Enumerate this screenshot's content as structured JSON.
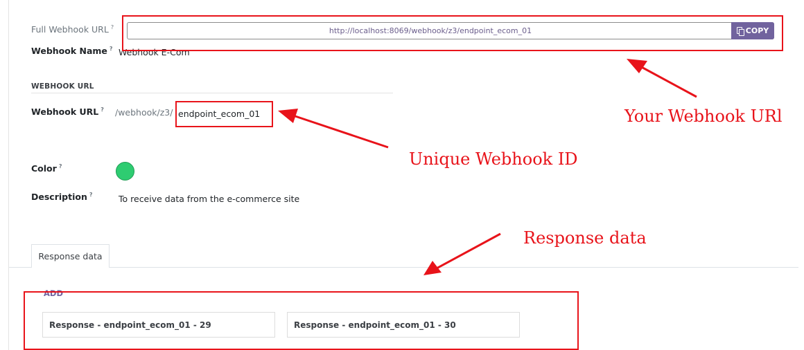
{
  "form": {
    "full_webhook_url_label": "Full Webhook URL",
    "full_webhook_url_value": "http://localhost:8069/webhook/z3/endpoint_ecom_01",
    "copy_label": "COPY",
    "webhook_name_label": "Webhook Name",
    "webhook_name_value": "Webhook E-Com",
    "section_title": "WEBHOOK URL",
    "webhook_url_label": "Webhook URL",
    "webhook_url_prefix": "/webhook/z3/",
    "webhook_url_value": "endpoint_ecom_01",
    "color_label": "Color",
    "color_value": "#2ecc71",
    "description_label": "Description",
    "description_value": "To receive data from the e-commerce site",
    "help_mark": "?"
  },
  "notebook": {
    "tab_label": "Response data",
    "add_label": "ADD",
    "responses": [
      {
        "label": "Response - endpoint_ecom_01 - 29"
      },
      {
        "label": "Response - endpoint_ecom_01 - 30"
      }
    ]
  },
  "annotations": {
    "webhook_url_note": "Your Webhook URl",
    "webhook_id_note": "Unique Webhook ID",
    "response_note": "Response data",
    "color": "#e8131a"
  },
  "icons": {
    "copy": "copy-icon"
  }
}
